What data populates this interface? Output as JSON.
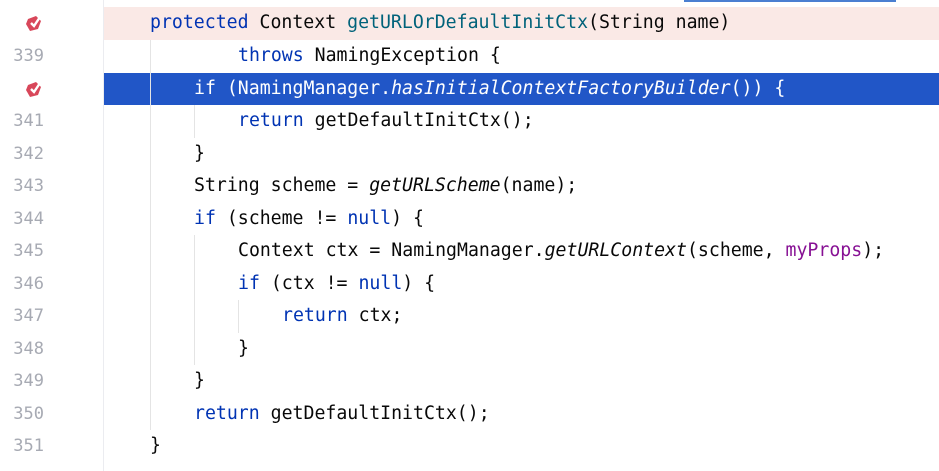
{
  "colors": {
    "breakpoint_line_bg": "#fae9e6",
    "selected_line_bg": "#2156c7",
    "keyword": "#0033b3",
    "method_decl": "#00627a",
    "field": "#871094",
    "line_number": "#a7aab3"
  },
  "gutter": {
    "breakpoint_icon": "breakpoint-check-icon",
    "line_numbers": [
      "339",
      "341",
      "342",
      "343",
      "344",
      "345",
      "346",
      "347",
      "348",
      "349",
      "350",
      "351"
    ]
  },
  "code": {
    "l1": {
      "kw_protected": "protected",
      "type": " Context ",
      "method": "getURLOrDefaultInitCtx",
      "rest": "(String name)"
    },
    "l2": {
      "kw_throws": "throws",
      "rest": " NamingException {"
    },
    "l3": {
      "kw_if": "if",
      "a": " (NamingManager.",
      "call": "hasInitialContextFactoryBuilder",
      "b": "()) {"
    },
    "l4": {
      "kw_return": "return",
      "rest": " getDefaultInitCtx();"
    },
    "l5": {
      "text": "}"
    },
    "l6": {
      "a": "String scheme = ",
      "call": "getURLScheme",
      "b": "(name);"
    },
    "l7": {
      "kw_if": "if",
      "a": " (scheme != ",
      "kw_null": "null",
      "b": ") {"
    },
    "l8": {
      "a": "Context ctx = NamingManager.",
      "call": "getURLContext",
      "b": "(scheme, ",
      "field": "myProps",
      "c": ");"
    },
    "l9": {
      "kw_if": "if",
      "a": " (ctx != ",
      "kw_null": "null",
      "b": ") {"
    },
    "l10": {
      "kw_return": "return",
      "rest": " ctx;"
    },
    "l11": {
      "text": "}"
    },
    "l12": {
      "text": "}"
    },
    "l13": {
      "kw_return": "return",
      "rest": " getDefaultInitCtx();"
    },
    "l14": {
      "text": "}"
    }
  }
}
